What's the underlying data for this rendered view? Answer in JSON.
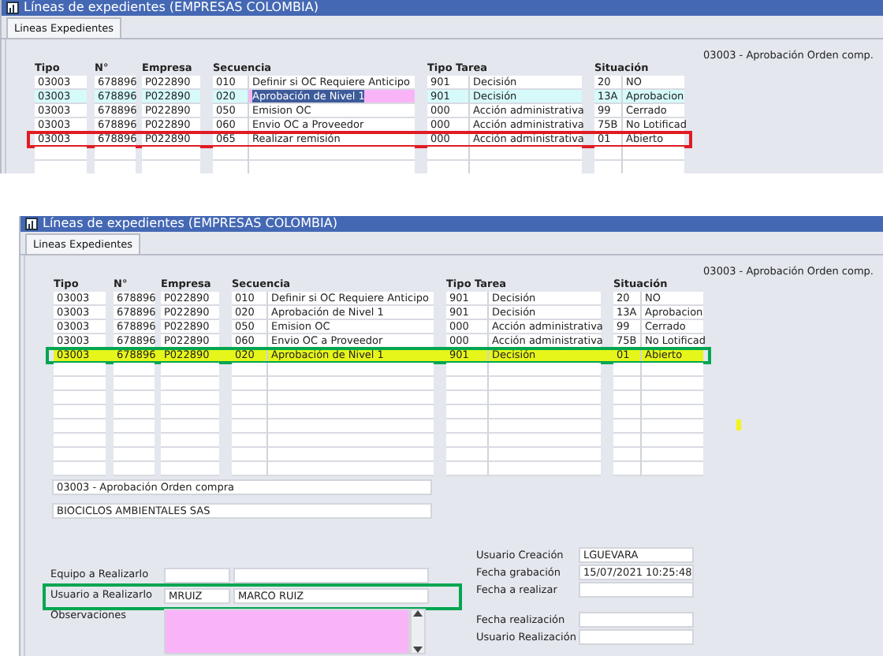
{
  "panels": [
    {
      "title": "Líneas de expedientes (EMPRESAS COLOMBIA)",
      "tabs": [
        {
          "label": "Lineas Expedientes",
          "selected": true
        }
      ],
      "header_note": "03003 - Aprobación Orden comp.",
      "columns": [
        "Tipo",
        "N°",
        "Empresa",
        "Secuencia",
        "Tipo Tarea",
        "Situación"
      ],
      "rows": [
        {
          "tipo": "03003",
          "numero": "678896",
          "empresa": "P022890",
          "secuencia_code": "010",
          "secuencia": "Definir si OC Requiere Anticipo",
          "tarea_code": "901",
          "tarea": "Decisión",
          "situacion_code": "20",
          "situacion": "NO",
          "selected": false,
          "editing": false,
          "marked": false
        },
        {
          "tipo": "03003",
          "numero": "678896",
          "empresa": "P022890",
          "secuencia_code": "020",
          "secuencia": "Aprobación de Nivel 1",
          "tarea_code": "901",
          "tarea": "Decisión",
          "situacion_code": "13A",
          "situacion": "Aprobacion",
          "selected": true,
          "editing": true,
          "marked": false
        },
        {
          "tipo": "03003",
          "numero": "678896",
          "empresa": "P022890",
          "secuencia_code": "050",
          "secuencia": "Emision OC",
          "tarea_code": "000",
          "tarea": "Acción administrativa",
          "situacion_code": "99",
          "situacion": "Cerrado",
          "selected": false,
          "editing": false,
          "marked": false
        },
        {
          "tipo": "03003",
          "numero": "678896",
          "empresa": "P022890",
          "secuencia_code": "060",
          "secuencia": "Envio OC a Proveedor",
          "tarea_code": "000",
          "tarea": "Acción administrativa",
          "situacion_code": "75B",
          "situacion": "No Lotificad",
          "selected": false,
          "editing": false,
          "marked": false
        },
        {
          "tipo": "03003",
          "numero": "678896",
          "empresa": "P022890",
          "secuencia_code": "065",
          "secuencia": "Realizar remisión",
          "tarea_code": "000",
          "tarea": "Acción administrativa",
          "situacion_code": "01",
          "situacion": "Abierto",
          "selected": false,
          "editing": false,
          "marked": false,
          "outlined": true
        }
      ]
    },
    {
      "title": "Líneas de expedientes (EMPRESAS COLOMBIA)",
      "tabs": [
        {
          "label": "Lineas Expedientes",
          "selected": true
        }
      ],
      "header_note": "03003 - Aprobación Orden comp.",
      "columns": [
        "Tipo",
        "N°",
        "Empresa",
        "Secuencia",
        "Tipo Tarea",
        "Situación"
      ],
      "rows": [
        {
          "tipo": "03003",
          "numero": "678896",
          "empresa": "P022890",
          "secuencia_code": "010",
          "secuencia": "Definir si OC Requiere Anticipo",
          "tarea_code": "901",
          "tarea": "Decisión",
          "situacion_code": "20",
          "situacion": "NO",
          "selected": false,
          "editing": false,
          "marked": false
        },
        {
          "tipo": "03003",
          "numero": "678896",
          "empresa": "P022890",
          "secuencia_code": "020",
          "secuencia": "Aprobación de Nivel 1",
          "tarea_code": "901",
          "tarea": "Decisión",
          "situacion_code": "13A",
          "situacion": "Aprobacion",
          "selected": false,
          "editing": false,
          "marked": false
        },
        {
          "tipo": "03003",
          "numero": "678896",
          "empresa": "P022890",
          "secuencia_code": "050",
          "secuencia": "Emision OC",
          "tarea_code": "000",
          "tarea": "Acción administrativa",
          "situacion_code": "99",
          "situacion": "Cerrado",
          "selected": false,
          "editing": false,
          "marked": false
        },
        {
          "tipo": "03003",
          "numero": "678896",
          "empresa": "P022890",
          "secuencia_code": "060",
          "secuencia": "Envio OC a Proveedor",
          "tarea_code": "000",
          "tarea": "Acción administrativa",
          "situacion_code": "75B",
          "situacion": "No Lotificad",
          "selected": false,
          "editing": false,
          "marked": false
        },
        {
          "tipo": "03003",
          "numero": "678896",
          "empresa": "P022890",
          "secuencia_code": "020",
          "secuencia": "Aprobación de Nivel 1",
          "tarea_code": "901",
          "tarea": "Decisión",
          "situacion_code": "01",
          "situacion": "Abierto",
          "selected": false,
          "editing": false,
          "marked": true,
          "outlined": true
        }
      ],
      "form": {
        "summary_fields": [
          "03003 - Aprobación Orden compra",
          "BIOCICLOS AMBIENTALES SAS"
        ],
        "left": [
          {
            "kind": "pair",
            "label": "Equipo a Realizarlo"
          },
          {
            "kind": "pair",
            "label": "Usuario a Realizarlo",
            "code": "MRUIZ",
            "name": "MARCO RUIZ",
            "outlined": true
          },
          {
            "kind": "memo",
            "label": "Observaciones"
          }
        ],
        "right_groups": [
          [
            {
              "label": "Usuario Creación",
              "value": "LGUEVARA"
            },
            {
              "label": "Fecha grabación",
              "value": "15/07/2021 10:25:48"
            },
            {
              "label": "Fecha a realizar"
            }
          ],
          [
            {
              "label": "Fecha realización"
            },
            {
              "label": "Usuario Realización"
            }
          ]
        ]
      }
    }
  ]
}
